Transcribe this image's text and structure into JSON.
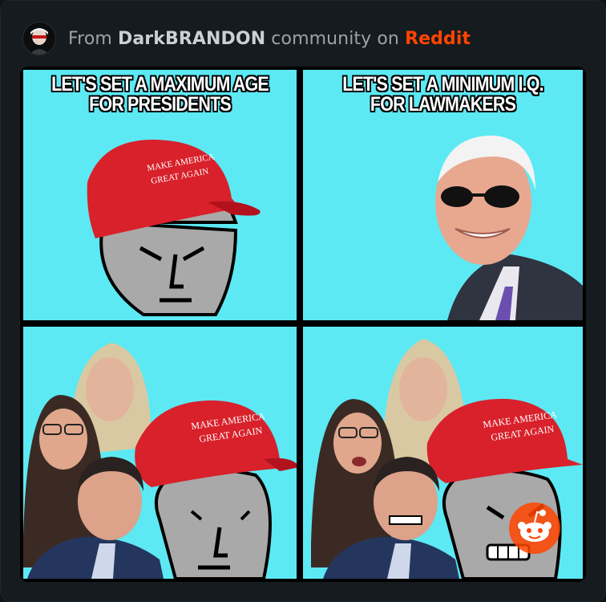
{
  "header": {
    "prefix": "From ",
    "community": "DarkBRANDON",
    "middle": " community on ",
    "platform": "Reddit"
  },
  "meme": {
    "panels": [
      {
        "caption_lines": [
          "LET'S SET A MAXIMUM AGE",
          "FOR PRESIDENTS"
        ],
        "hat_text": [
          "MAKE AMERICA",
          "GREAT AGAIN"
        ]
      },
      {
        "caption_lines": [
          "LET'S SET A MINIMUM I.Q.",
          "FOR LAWMAKERS"
        ]
      },
      {
        "hat_text": [
          "MAKE AMERICA",
          "GREAT AGAIN"
        ]
      },
      {
        "hat_text": [
          "MAKE AMERICA",
          "GREAT AGAIN"
        ]
      }
    ]
  },
  "colors": {
    "panel_bg": "#5ce9f4",
    "hat_red": "#d8212b",
    "npc_gray": "#a9a9a9",
    "reddit_orange": "#ff4500"
  }
}
